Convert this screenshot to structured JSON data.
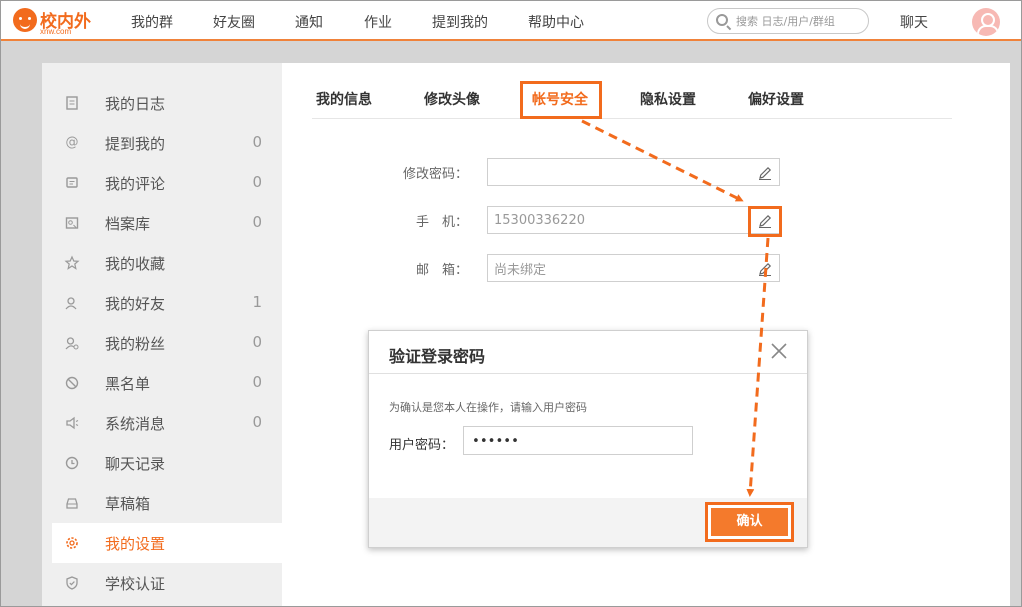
{
  "brand": {
    "name": "校内外",
    "domain": "xnw.com",
    "color": "#f26b1d"
  },
  "nav": {
    "items": [
      "我的群",
      "好友圈",
      "通知",
      "作业",
      "提到我的",
      "帮助中心"
    ],
    "search_placeholder": "搜索 日志/用户/群组",
    "chat_label": "聊天"
  },
  "sidebar": {
    "items": [
      {
        "label": "我的日志",
        "count": "",
        "icon": "journal-icon"
      },
      {
        "label": "提到我的",
        "count": "0",
        "icon": "at-icon"
      },
      {
        "label": "我的评论",
        "count": "0",
        "icon": "comment-icon"
      },
      {
        "label": "档案库",
        "count": "0",
        "icon": "archive-icon"
      },
      {
        "label": "我的收藏",
        "count": "",
        "icon": "star-icon"
      },
      {
        "label": "我的好友",
        "count": "1",
        "icon": "friends-icon"
      },
      {
        "label": "我的粉丝",
        "count": "0",
        "icon": "fans-icon"
      },
      {
        "label": "黑名单",
        "count": "0",
        "icon": "block-icon"
      },
      {
        "label": "系统消息",
        "count": "0",
        "icon": "speaker-icon"
      },
      {
        "label": "聊天记录",
        "count": "",
        "icon": "clock-icon"
      },
      {
        "label": "草稿箱",
        "count": "",
        "icon": "drafts-icon"
      },
      {
        "label": "我的设置",
        "count": "",
        "icon": "gear-icon",
        "active": true
      },
      {
        "label": "学校认证",
        "count": "",
        "icon": "shield-icon"
      }
    ]
  },
  "tabs": [
    "我的信息",
    "修改头像",
    "帐号安全",
    "隐私设置",
    "偏好设置"
  ],
  "active_tab": "帐号安全",
  "form": {
    "password_label": "修改密码：",
    "password_value": "",
    "phone_label": "手　机：",
    "phone_value": "15300336220",
    "email_label": "邮　箱：",
    "email_value": "尚未绑定"
  },
  "modal": {
    "title": "验证登录密码",
    "hint": "为确认是您本人在操作，请输入用户密码",
    "password_label": "用户密码：",
    "password_value": "••••••",
    "confirm_label": "确认"
  },
  "colors": {
    "accent": "#f26b1d",
    "sidebar_bg": "#efefef",
    "page_bg": "#d5d5d5"
  }
}
